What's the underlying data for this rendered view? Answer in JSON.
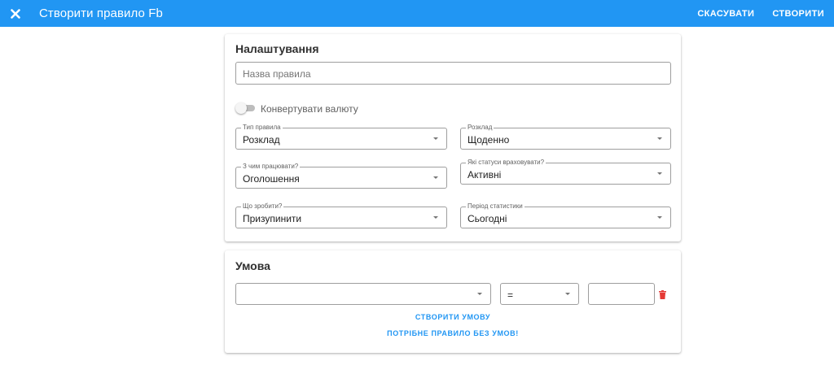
{
  "appbar": {
    "close_icon": "close-icon",
    "title": "Створити правило Fb",
    "cancel_label": "СКАСУВАТИ",
    "create_label": "СТВОРИТИ",
    "color": "#2196f3"
  },
  "settings": {
    "heading": "Налаштування",
    "rule_name": {
      "placeholder": "Назва правила",
      "value": ""
    },
    "convert_currency": {
      "label": "Конвертувати валюту",
      "on": false
    },
    "rule_type": {
      "label": "Тип правила",
      "value": "Розклад"
    },
    "schedule": {
      "label": "Розклад",
      "value": "Щоденно"
    },
    "work_with": {
      "label": "З чим працювати?",
      "value": "Оголошення"
    },
    "statuses": {
      "label": "Які статуси враховувати?",
      "value": "Активні"
    },
    "action": {
      "label": "Що зробити?",
      "value": "Призупинити"
    },
    "stats_period": {
      "label": "Період статистики",
      "value": "Сьогодні"
    }
  },
  "condition": {
    "heading": "Умова",
    "metric": {
      "value": ""
    },
    "operator": {
      "value": "="
    },
    "amount": {
      "value": ""
    },
    "delete_icon": "trash-icon",
    "delete_color": "#e53935",
    "create_condition_label": "СТВОРИТИ УМОВУ",
    "no_condition_label": "ПОТРІБНЕ ПРАВИЛО БЕЗ УМОВ!"
  }
}
